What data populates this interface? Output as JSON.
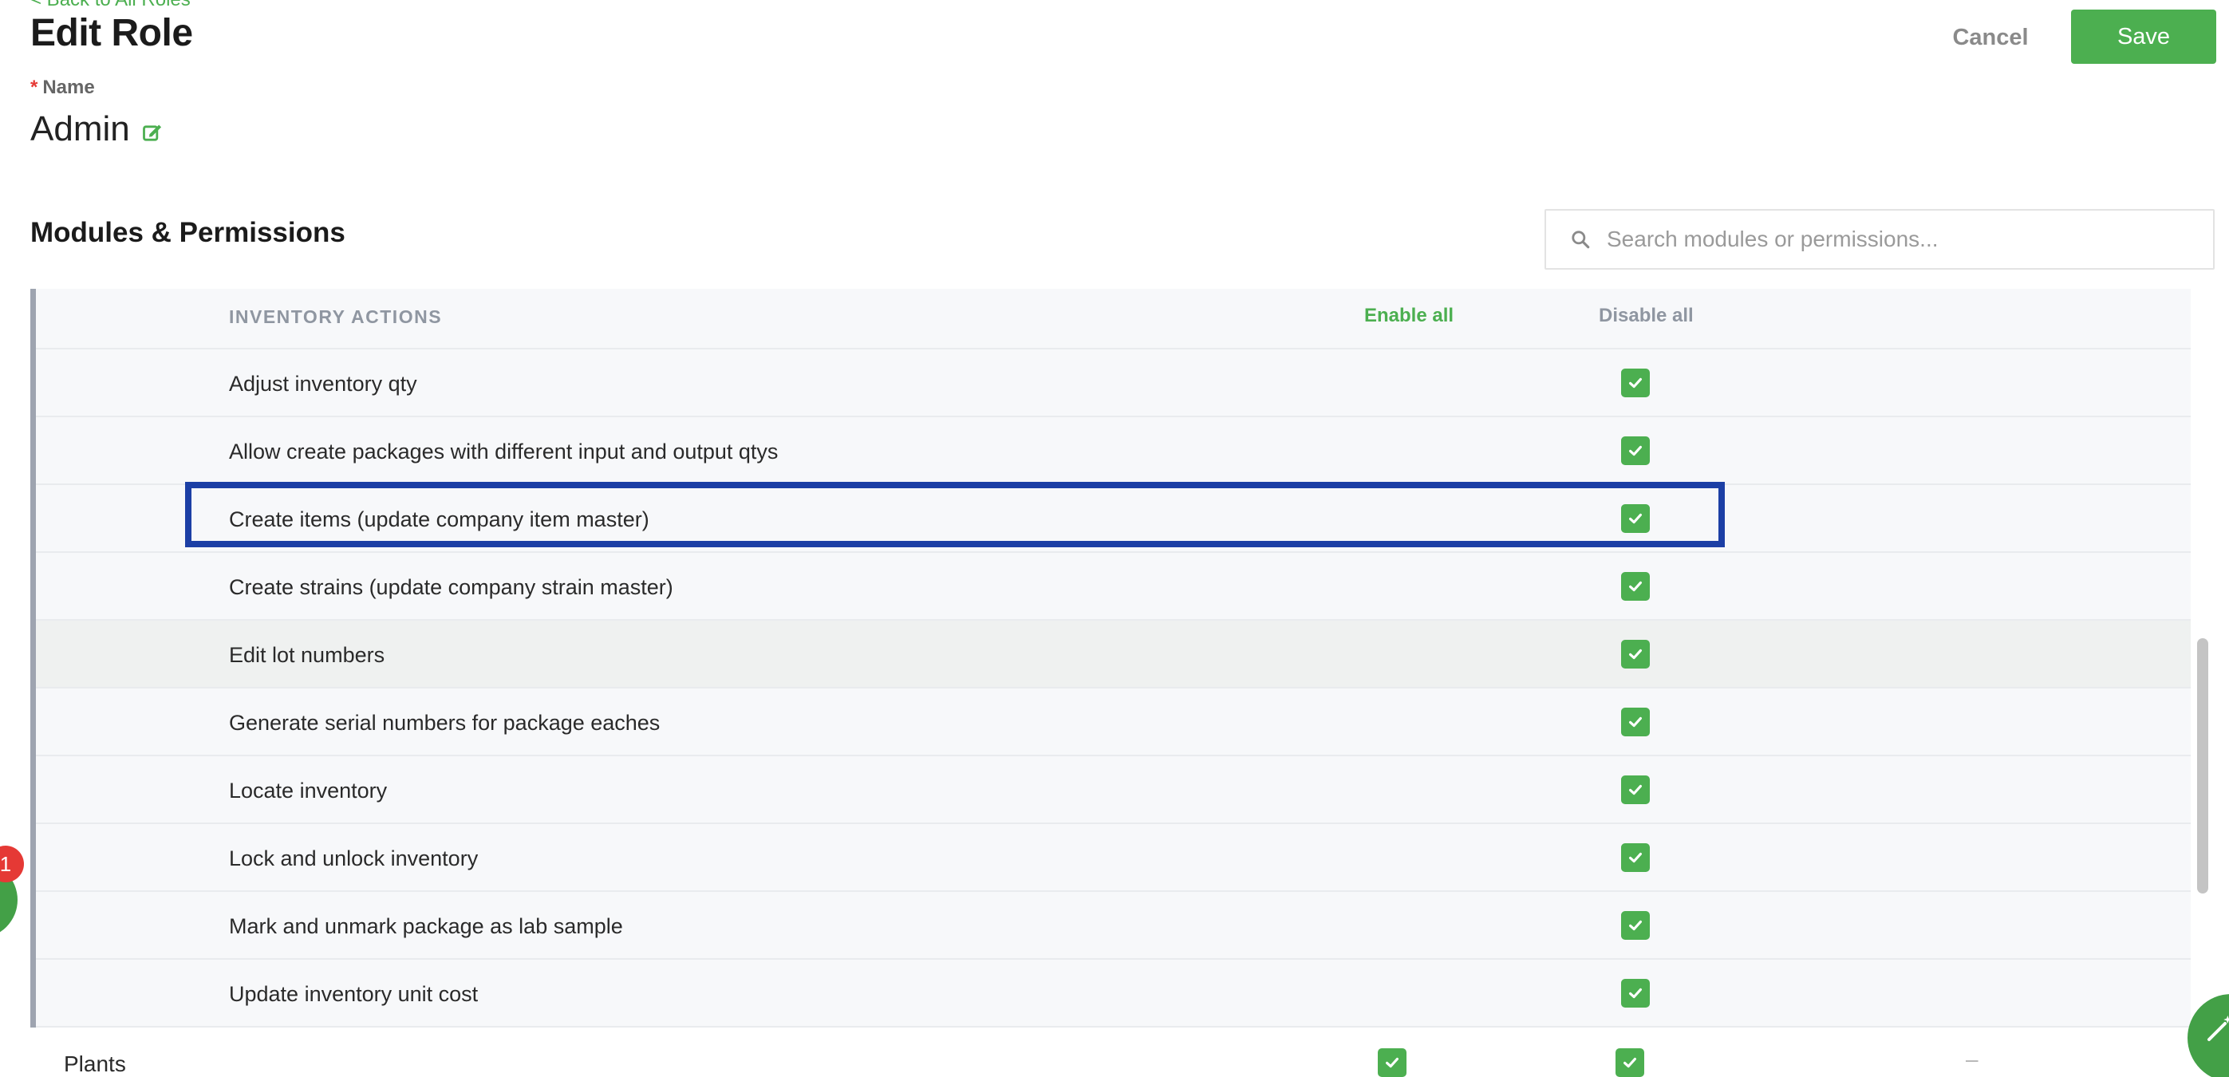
{
  "header": {
    "back_link": "< Back to All Roles",
    "title": "Edit Role",
    "cancel_label": "Cancel",
    "save_label": "Save"
  },
  "name_field": {
    "label": "Name",
    "required_marker": "*",
    "value": "Admin"
  },
  "permissions": {
    "section_title": "Modules & Permissions",
    "search_placeholder": "Search modules or permissions...",
    "group": {
      "header": "INVENTORY ACTIONS",
      "enable_all": "Enable all",
      "disable_all": "Disable all",
      "items": [
        {
          "label": "Adjust inventory qty",
          "checked": true
        },
        {
          "label": "Allow create packages with different input and output qtys",
          "checked": true
        },
        {
          "label": "Create items (update company item master)",
          "checked": true
        },
        {
          "label": "Create strains (update company strain master)",
          "checked": true
        },
        {
          "label": "Edit lot numbers",
          "checked": true
        },
        {
          "label": "Generate serial numbers for package eaches",
          "checked": true
        },
        {
          "label": "Locate inventory",
          "checked": true
        },
        {
          "label": "Lock and unlock inventory",
          "checked": true
        },
        {
          "label": "Mark and unmark package as lab sample",
          "checked": true
        },
        {
          "label": "Update inventory unit cost",
          "checked": true
        }
      ]
    },
    "modules": [
      {
        "label": "Plants",
        "enabled": true,
        "disabled": true,
        "extra": "–"
      }
    ]
  },
  "notifications": {
    "badge_count": "1"
  },
  "colors": {
    "accent": "#4caf50",
    "highlight": "#1c3fa5",
    "required": "#e53935"
  },
  "icons": {
    "edit": "edit-icon",
    "search": "search-icon",
    "check": "check-icon",
    "tool": "wand-icon"
  }
}
